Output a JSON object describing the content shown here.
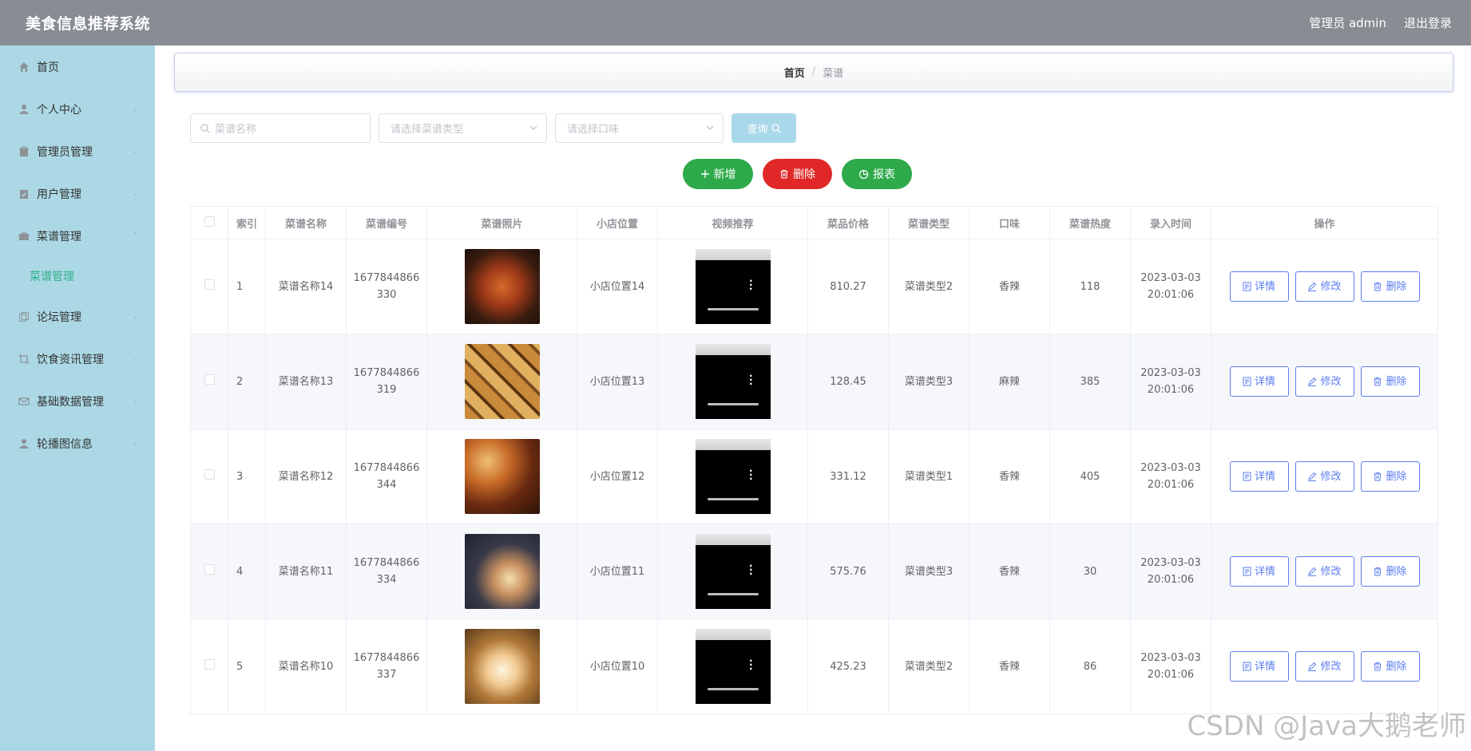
{
  "header": {
    "title": "美食信息推荐系统",
    "user": "管理员 admin",
    "logout": "退出登录"
  },
  "sidebar": {
    "items": [
      {
        "label": "首页"
      },
      {
        "label": "个人中心"
      },
      {
        "label": "管理员管理"
      },
      {
        "label": "用户管理"
      },
      {
        "label": "菜谱管理"
      },
      {
        "label": "论坛管理"
      },
      {
        "label": "饮食资讯管理"
      },
      {
        "label": "基础数据管理"
      },
      {
        "label": "轮播图信息"
      }
    ],
    "sub_active": "菜谱管理"
  },
  "breadcrumb": {
    "home": "首页",
    "sep": "/",
    "current": "菜谱"
  },
  "search": {
    "name_placeholder": "菜谱名称",
    "type_placeholder": "请选择菜谱类型",
    "taste_placeholder": "请选择口味",
    "query_label": "查询"
  },
  "actions": {
    "add": "新增",
    "delete": "删除",
    "report": "报表"
  },
  "table": {
    "headers": [
      "索引",
      "菜谱名称",
      "菜谱编号",
      "菜谱照片",
      "小店位置",
      "视频推荐",
      "菜品价格",
      "菜谱类型",
      "口味",
      "菜谱热度",
      "录入时间",
      "操作"
    ],
    "rows": [
      {
        "idx": "1",
        "name": "菜谱名称14",
        "code1": "1677844866",
        "code2": "330",
        "shop": "小店位置14",
        "price": "810.27",
        "type": "菜谱类型2",
        "taste": "香辣",
        "heat": "118",
        "date": "2023-03-03",
        "time": "20:01:06"
      },
      {
        "idx": "2",
        "name": "菜谱名称13",
        "code1": "1677844866",
        "code2": "319",
        "shop": "小店位置13",
        "price": "128.45",
        "type": "菜谱类型3",
        "taste": "麻辣",
        "heat": "385",
        "date": "2023-03-03",
        "time": "20:01:06"
      },
      {
        "idx": "3",
        "name": "菜谱名称12",
        "code1": "1677844866",
        "code2": "344",
        "shop": "小店位置12",
        "price": "331.12",
        "type": "菜谱类型1",
        "taste": "香辣",
        "heat": "405",
        "date": "2023-03-03",
        "time": "20:01:06"
      },
      {
        "idx": "4",
        "name": "菜谱名称11",
        "code1": "1677844866",
        "code2": "334",
        "shop": "小店位置11",
        "price": "575.76",
        "type": "菜谱类型3",
        "taste": "香辣",
        "heat": "30",
        "date": "2023-03-03",
        "time": "20:01:06"
      },
      {
        "idx": "5",
        "name": "菜谱名称10",
        "code1": "1677844866",
        "code2": "337",
        "shop": "小店位置10",
        "price": "425.23",
        "type": "菜谱类型2",
        "taste": "香辣",
        "heat": "86",
        "date": "2023-03-03",
        "time": "20:01:06"
      }
    ],
    "op_detail": "详情",
    "op_edit": "修改",
    "op_delete": "删除"
  },
  "watermark": "CSDN @Java大鹅老师"
}
